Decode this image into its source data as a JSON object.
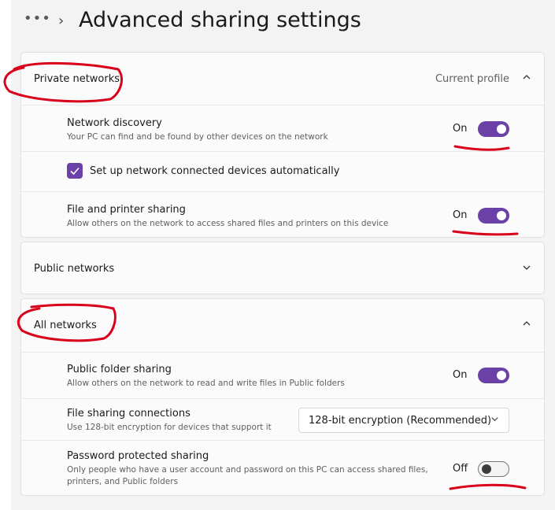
{
  "header": {
    "more_glyph": "•••",
    "breadcrumb_chevron": "›",
    "title": "Advanced sharing settings"
  },
  "private_networks": {
    "label": "Private networks",
    "badge": "Current profile",
    "expanded": true,
    "network_discovery": {
      "title": "Network discovery",
      "description": "Your PC can find and be found by other devices on the network",
      "state": "On",
      "on": true
    },
    "auto_setup": {
      "label": "Set up network connected devices automatically",
      "checked": true
    },
    "file_printer_sharing": {
      "title": "File and printer sharing",
      "description": "Allow others on the network to access shared files and printers on this device",
      "state": "On",
      "on": true
    }
  },
  "public_networks": {
    "label": "Public networks",
    "expanded": false
  },
  "all_networks": {
    "label": "All networks",
    "expanded": true,
    "public_folder_sharing": {
      "title": "Public folder sharing",
      "description": "Allow others on the network to read and write files in Public folders",
      "state": "On",
      "on": true
    },
    "file_sharing_connections": {
      "title": "File sharing connections",
      "description": "Use 128-bit encryption for devices that support it",
      "selected": "128-bit encryption (Recommended)"
    },
    "password_protected_sharing": {
      "title": "Password protected sharing",
      "description_line1": "Only people who have a user account and password on this PC can access shared files,",
      "description_line2": "printers, and Public folders",
      "state": "Off",
      "on": false
    }
  },
  "icons": {
    "more": "more-icon",
    "breadcrumb": "chevron-right-icon",
    "expand": "chevron-up-icon",
    "collapse": "chevron-down-icon",
    "check": "checkmark-icon"
  },
  "colors": {
    "accent": "#6b41a8",
    "annotation": "#d9001b"
  }
}
